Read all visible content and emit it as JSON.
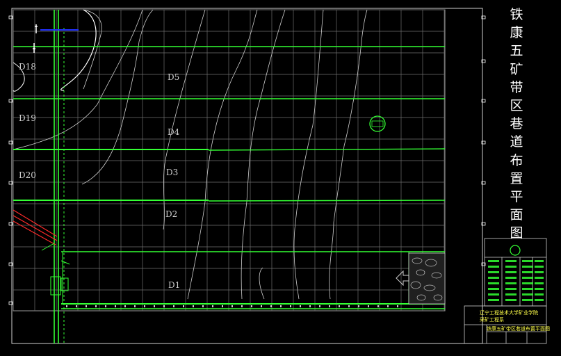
{
  "drawing": {
    "title": "铁康五矿带区巷道布置平面图",
    "title_chars": [
      "铁",
      "康",
      "五",
      "矿",
      "带",
      "区",
      "巷",
      "道",
      "布",
      "置",
      "平",
      "面",
      "图"
    ]
  },
  "zones": {
    "d18": "D18",
    "d19": "D19",
    "d20": "D20",
    "d5": "D5",
    "d4": "D4",
    "d3": "D3",
    "d2": "D2",
    "d1": "D1"
  },
  "title_block": {
    "school": "辽宁工程技术大学矿业学院",
    "dept": "采矿工程系",
    "drawing_name": "铁康五矿带区巷道布置平面图"
  },
  "colors": {
    "background": "#000000",
    "roadway": "#33ff33",
    "grid": "#8a8a8a",
    "contour": "#d0d0d0",
    "fault": "#ff2a2a",
    "marker": "#2030ff"
  }
}
